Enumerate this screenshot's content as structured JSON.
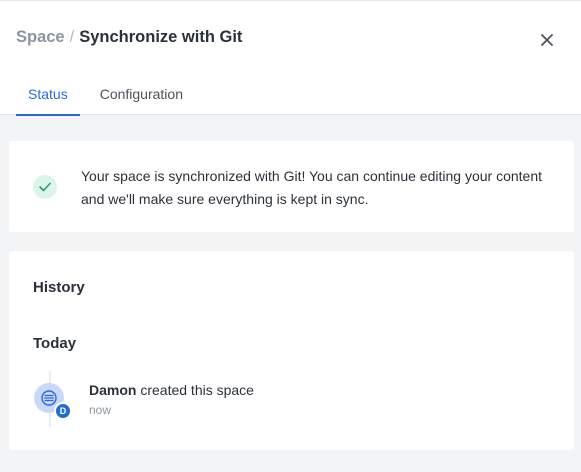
{
  "header": {
    "breadcrumb_parent": "Space",
    "breadcrumb_separator": "/",
    "title": "Synchronize with Git",
    "close_icon": "close-icon"
  },
  "tabs": [
    {
      "label": "Status",
      "active": true
    },
    {
      "label": "Configuration",
      "active": false
    }
  ],
  "status": {
    "icon": "checkmark-icon",
    "message": "Your space is synchronized with Git! You can continue editing your content and we'll make sure everything is kept in sync."
  },
  "history": {
    "title": "History",
    "groups": [
      {
        "day": "Today",
        "events": [
          {
            "avatar_icon": "space-icon",
            "user_initial": "D",
            "user": "Damon",
            "action": "created this space",
            "time": "now"
          }
        ]
      }
    ]
  },
  "colors": {
    "accent": "#2b6ad6",
    "success_bg": "#dcf5ea",
    "success": "#2e9b6c",
    "badge": "#1f6fd1"
  }
}
